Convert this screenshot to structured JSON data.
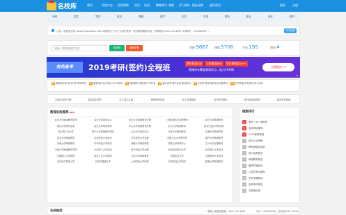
{
  "header": {
    "logo_text": "名校库",
    "nav": [
      "首页",
      "学校大全",
      "招生简章",
      "资讯",
      "培训",
      "教育资讯",
      "课程",
      "学习资料",
      "招标采购",
      "留学资讯"
    ],
    "login": "登录",
    "register": "注册"
  },
  "subnav": [
    "考研",
    "招生",
    "学历",
    "资讯",
    "课程",
    "留学",
    "论文",
    "外语",
    "财会",
    "职业",
    "考证",
    "资料"
  ],
  "notice": {
    "text": "公告：欢迎您访问 www.mingxiaoku.com 本站致力于为广大用户提供一站式教育服务平台，咨询热线 400-123-4567 QQ群号：123456789 ...",
    "qq_label": "QQ交流"
  },
  "search": {
    "placeholder": "请输入您要搜索的内容",
    "btn_school": "找学校",
    "btn_search": "搜索学校",
    "stats": [
      {
        "label": "学校",
        "value": "9867"
      },
      {
        "label": "课程",
        "value": "5708"
      },
      {
        "label": "专业",
        "value": "195"
      },
      {
        "label": "资料",
        "value": "4"
      }
    ]
  },
  "banner": {
    "tag": "抢先备考",
    "title": "2019考研(签约)全程班",
    "chips": [
      "两科直减400",
      "三科直减800",
      "专业课直减1000"
    ],
    "line2": "直播多年覆盖高频考点，助力19考研",
    "cta": "立即报名>>",
    "ad": "AD"
  },
  "tags": [
    [
      "热",
      "最新校友录·重点大学·考研资料"
    ],
    [
      "荐",
      "英语培训·会计考证·2019考研"
    ],
    [
      "热",
      "网络教育·远程学历·专升本"
    ],
    [
      "新",
      "留学咨询·海外名校·语言培训"
    ],
    [
      "荐",
      "公务员·教师资格·职业资格考试"
    ],
    [
      "热",
      "艺术考级·自考报名·成人高考"
    ]
  ],
  "quicklinks": [
    "中国名校排行榜",
    "高校招生简章",
    "自主招生名单",
    "考研院校查询",
    "成人高考报名",
    "自学考试报名",
    "专升本信息查询",
    "留学申请指南"
  ],
  "schools": {
    "title": "教育机构推荐",
    "new": "NEW",
    "items": [
      "北京大学继续教育学院",
      "清华大学培训中心",
      "复旦大学网络教育学院",
      "上海交通大学远程教育",
      "浙江大学继续教育",
      "南京大学研究生院",
      "武汉大学培训学院",
      "中山大学继续教育学院",
      "四川大学网络教育",
      "西安交通大学研修院",
      "哈尔滨工业大学",
      "厦门大学继续教育学院",
      "山东大学培训中心",
      "吉林大学网络教育",
      "天津大学研修学院",
      "同济大学继续教育",
      "北京师范大学培训",
      "华东师范大学远程",
      "中国人民大学研究院",
      "南开大学继续教育",
      "东南大学网络教育",
      "华中科技大学培训",
      "湖南大学继续教育",
      "重庆大学研修中心",
      "兰州大学远程教育",
      "中南大学继续教育学院",
      "大连理工大学培训",
      "电子科技大学远程",
      "北京航空航天大学",
      "北京理工大学培训",
      "华南理工大学研修",
      "西北工业大学网络",
      "东北大学继续教育",
      "中国农业大学",
      "中国海洋大学培训",
      "对外经济贸易大学",
      "北京外国语大学",
      "上海财经大学研修",
      "中央财经大学培训",
      "暨南大学继续教育"
    ]
  },
  "ranking": {
    "title": "搜索排行",
    "items": [
      "考研一对一辅导班",
      "名师考研辅导",
      "2019考研英语",
      "会计从业资格",
      "教师资格证培训",
      "成人高考报名",
      "网络教育报名",
      "雅思托福培训",
      "公务员考试辅导",
      "专升本辅导班",
      "自考本科报名",
      "艺考培训班"
    ]
  },
  "bottom": {
    "title": "名校推荐",
    "right": [
      "学校入驻咨询热线：400-123-4567",
      "QQ：123456789（工作日9:00-18:00）"
    ]
  }
}
